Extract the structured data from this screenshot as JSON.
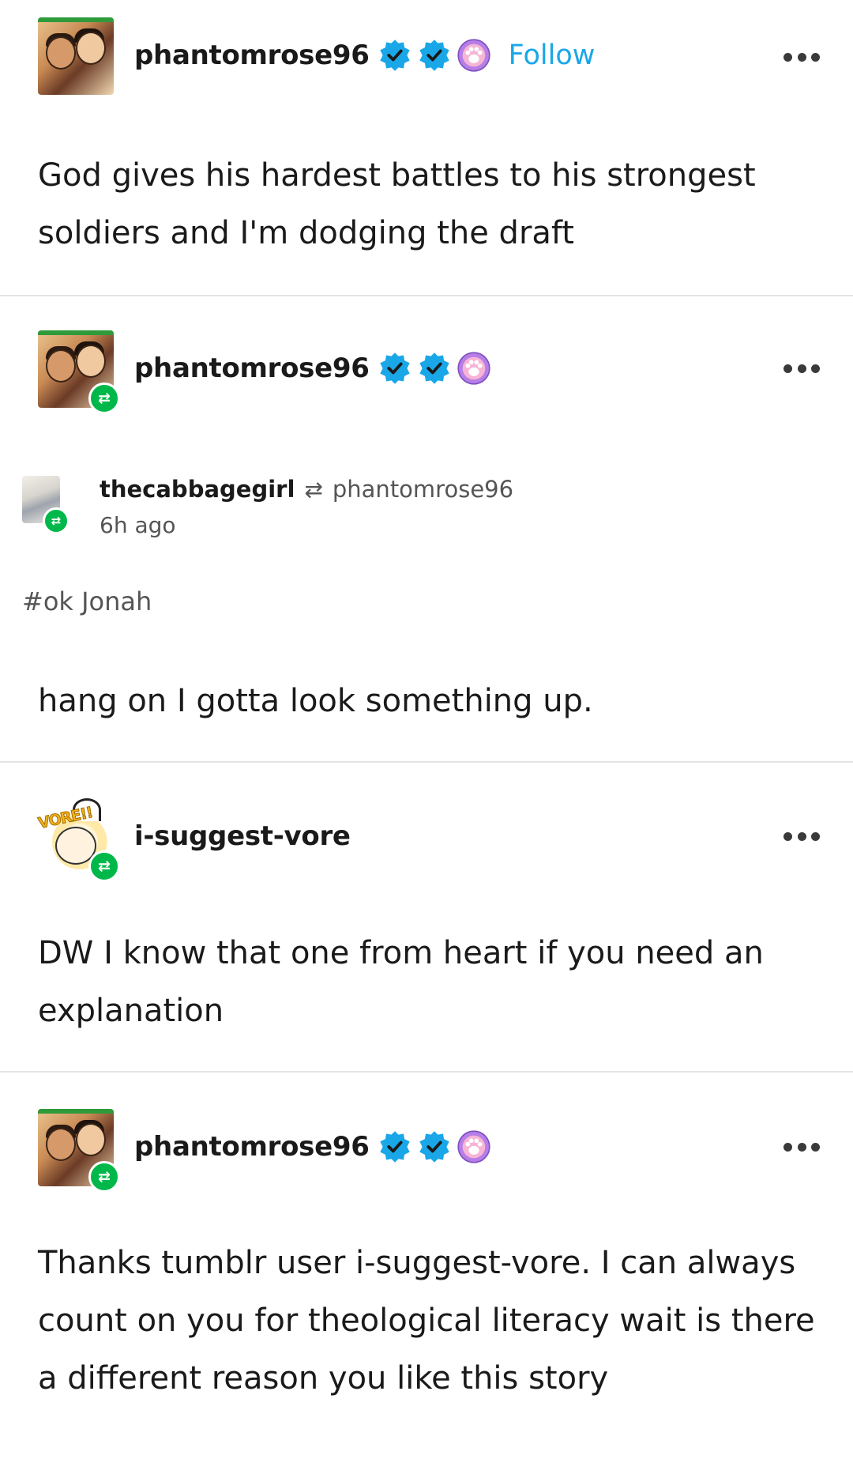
{
  "posts": [
    {
      "username": "phantomrose96",
      "follow_label": "Follow",
      "text": "God gives his hardest battles to his strongest soldiers and I'm dodging the draft"
    },
    {
      "username": "phantomrose96",
      "trail": {
        "user": "thecabbagegirl",
        "source": "phantomrose96",
        "time": "6h ago"
      },
      "tag": "#ok Jonah",
      "text": "hang on I gotta look something up."
    },
    {
      "username": "i-suggest-vore",
      "avatar_text": "VORE!!",
      "text": "DW I know that one from heart if you need an explanation"
    },
    {
      "username": "phantomrose96",
      "text": "Thanks tumblr user i-suggest-vore. I can always count on you for theological literacy wait is there a different reason you like this story"
    }
  ],
  "icons": {
    "verified": "verified-checkmark-badge-icon",
    "paw": "paw-badge-icon",
    "reblog": "reblog-icon",
    "more": "more-options-icon"
  },
  "colors": {
    "follow": "#1aa7e8",
    "verified": "#1aa7e8",
    "reblog": "#00b84a",
    "paw": "#b77ee6"
  }
}
